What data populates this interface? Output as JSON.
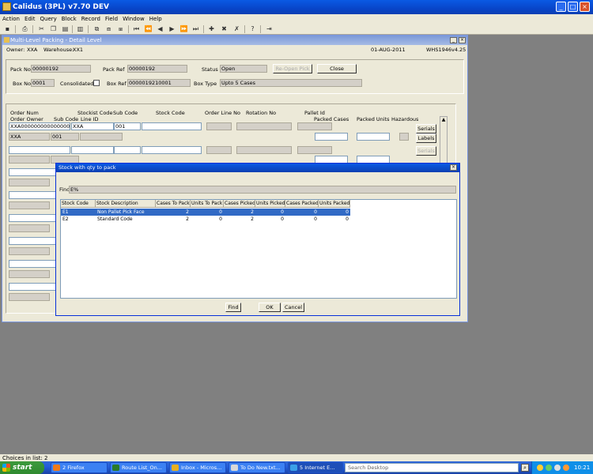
{
  "app": {
    "title": "Calidus (3PL) v7.70 DEV",
    "menu": [
      "Action",
      "Edit",
      "Query",
      "Block",
      "Record",
      "Field",
      "Window",
      "Help"
    ]
  },
  "child": {
    "title": "Multi-Level Packing - Detail Level",
    "owner_label": "Owner:",
    "owner": "XXA",
    "warehouse_label": "Warehouse:",
    "warehouse": "XX1",
    "date": "01-AUG-2011",
    "form_id": "WHS1946",
    "version": "v4.25"
  },
  "header": {
    "pack_no_label": "Pack No",
    "pack_no": "00000192",
    "pack_ref_label": "Pack Ref",
    "pack_ref": "00000192",
    "status_label": "Status",
    "status": "Open",
    "reopen_button": "Re-Open Pick",
    "close_button": "Close",
    "box_no_label": "Box No",
    "box_no": "0001",
    "consolidated_label": "Consolidated",
    "box_ref_label": "Box Ref",
    "box_ref": "0000019210001",
    "box_type_label": "Box Type",
    "box_type": "Upto 5 Cases"
  },
  "detail": {
    "col_order_num": "Order Num",
    "col_order_owner": "Order Owner",
    "col_sub_code": "Sub Code",
    "col_stockist_code": "Stockist Code",
    "col_line_id": "Line ID",
    "col_sub_code2": "Sub Code",
    "col_stock_code": "Stock Code",
    "col_order_line_no": "Order Line No",
    "col_rotation_no": "Rotation No",
    "col_pallet_id": "Pallet Id",
    "col_packed_cases": "Packed Cases",
    "col_packed_units": "Packed Units",
    "col_hazardous": "Hazardous",
    "order_num": "XXA000000000000000509",
    "stockist_code": "XXA",
    "sub_code": "001",
    "order_owner": "XXA",
    "sub_code_b": "001",
    "serials_button": "Serials",
    "labels_button": "Labels"
  },
  "dialog": {
    "title": "Stock with qty to pack",
    "find_label": "Find",
    "find_value": "E%",
    "columns": [
      "Stock Code",
      "Stock Description",
      "Cases To Pack",
      "Units To Pack",
      "Cases Picked",
      "Units Picked",
      "Cases Packed",
      "Units Packed"
    ],
    "rows": [
      [
        "E1",
        "Non Pallet Pick Face",
        "2",
        "0",
        "2",
        "0",
        "0",
        "0"
      ],
      [
        "E2",
        "Standard Code",
        "2",
        "0",
        "2",
        "0",
        "0",
        "0"
      ]
    ],
    "find_button": "Find",
    "ok_button": "OK",
    "cancel_button": "Cancel"
  },
  "status_text": "Choices in list: 2",
  "taskbar": {
    "start": "start",
    "tasks": [
      "2 Firefox",
      "Route List_On...",
      "Inbox - Micros...",
      "To Do New.txt...",
      "5 Internet E..."
    ],
    "search_placeholder": "Search Desktop",
    "clock": "10:21"
  }
}
